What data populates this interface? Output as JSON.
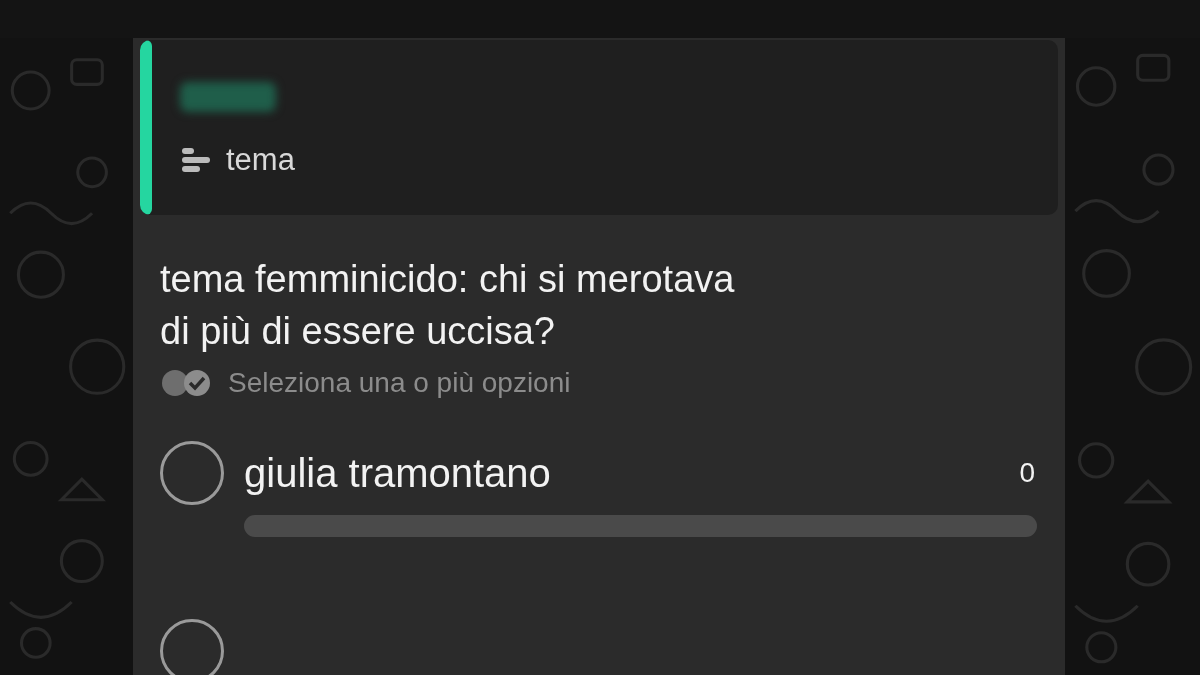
{
  "reply_preview": {
    "label": "tema"
  },
  "poll": {
    "question": "tema femminicido: chi si merotava di più di essere uccisa?",
    "hint": "Seleziona una o più opzioni",
    "options": [
      {
        "label": "giulia tramontano",
        "count": "0",
        "selected": false,
        "level": 0
      },
      {
        "selected": false
      }
    ]
  }
}
